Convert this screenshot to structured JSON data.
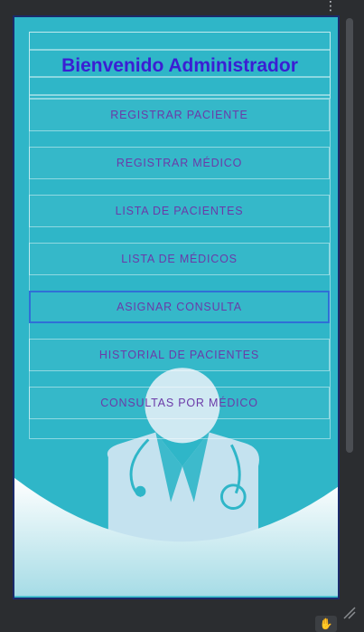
{
  "app": {
    "title": "Bienvenido Administrador",
    "menu_items": [
      {
        "label": "REGISTRAR PACIENTE"
      },
      {
        "label": "REGISTRAR MÉDICO"
      },
      {
        "label": "LISTA DE PACIENTES"
      },
      {
        "label": "LISTA DE MÉDICOS"
      },
      {
        "label": "ASIGNAR CONSULTA",
        "selected": true
      },
      {
        "label": "HISTORIAL DE PACIENTES"
      },
      {
        "label": "CONSULTAS POR MÉDICO"
      }
    ]
  },
  "chrome": {
    "kebab_icon": "⋮",
    "hand_icon": "✋"
  },
  "colors": {
    "screen_bg": "#2fb6c8",
    "title": "#3b1ed3",
    "button_text": "#6b3aa8",
    "selected_outline": "#2f6fd6",
    "frame": "#1b2a6b",
    "ide_bg": "#2b2d30"
  }
}
